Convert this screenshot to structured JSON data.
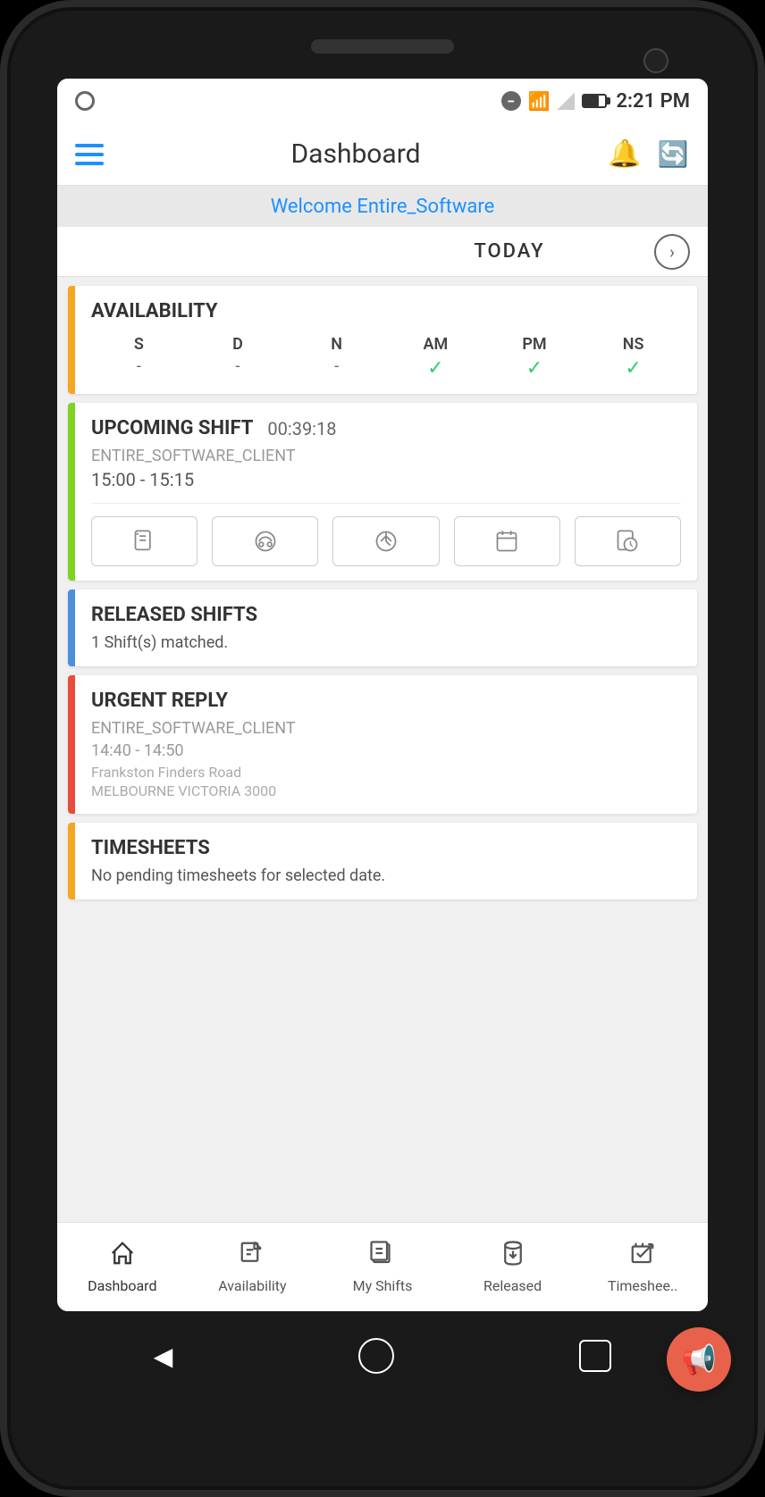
{
  "status": {
    "time": "2:21 PM"
  },
  "header": {
    "title": "Dashboard",
    "menu_label": "Menu",
    "bell_label": "Notifications",
    "refresh_label": "Refresh"
  },
  "welcome": {
    "text": "Welcome Entire_Software"
  },
  "today": {
    "label": "TODAY",
    "arrow": "›"
  },
  "availability": {
    "title": "AVAILABILITY",
    "headers": [
      "S",
      "D",
      "N",
      "AM",
      "PM",
      "NS"
    ],
    "values": [
      "-",
      "-",
      "-",
      "✓",
      "✓",
      "✓"
    ]
  },
  "upcoming_shift": {
    "title": "UPCOMING SHIFT",
    "timer": "00:39:18",
    "client": "ENTIRE_SOFTWARE_CLIENT",
    "time": "15:00 - 15:15",
    "actions": [
      "📋",
      "🚗",
      "🎯",
      "📅",
      "📊"
    ]
  },
  "released_shifts": {
    "title": "RELEASED SHIFTS",
    "sub": "1 Shift(s) matched."
  },
  "urgent_reply": {
    "title": "URGENT REPLY",
    "client": "ENTIRE_SOFTWARE_CLIENT",
    "time": "14:40 - 14:50",
    "address": "Frankston Finders Road",
    "city": "MELBOURNE VICTORIA 3000"
  },
  "timesheets": {
    "title": "TIMESHEETS",
    "sub": "No pending timesheets for selected date."
  },
  "bottom_nav": {
    "items": [
      {
        "label": "Dashboard",
        "icon": "🏠",
        "active": true
      },
      {
        "label": "Availability",
        "icon": "✏️",
        "active": false
      },
      {
        "label": "My Shifts",
        "icon": "📋",
        "active": false
      },
      {
        "label": "Released",
        "icon": "🪣",
        "active": false
      },
      {
        "label": "Timeshee..",
        "icon": "🛒",
        "active": false
      }
    ]
  },
  "fab": {
    "icon": "📢"
  },
  "colors": {
    "availability_accent": "#f5a623",
    "upcoming_shift_accent": "#7ed321",
    "released_accent": "#4a90d9",
    "urgent_accent": "#e74c3c",
    "timesheets_accent": "#f5a623"
  }
}
